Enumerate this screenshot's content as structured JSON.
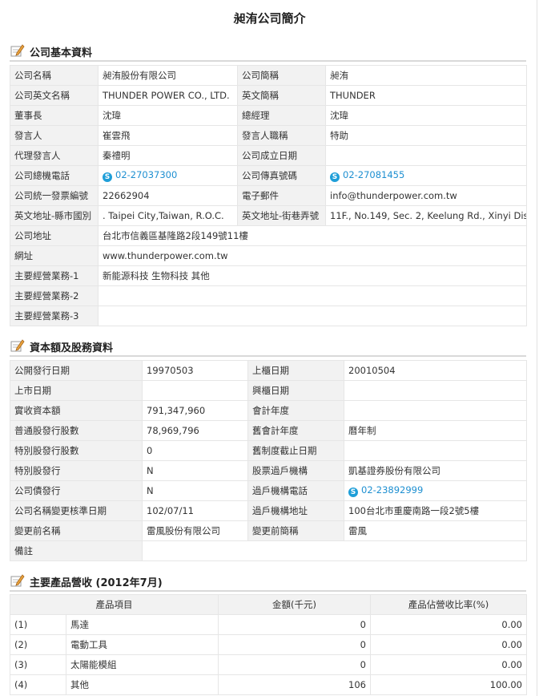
{
  "page_title": "昶洧公司簡介",
  "icons": {
    "section": "pencil-edit-icon",
    "phone": "skype-phone-icon"
  },
  "basic": {
    "title": "公司基本資料",
    "rows": [
      {
        "l1": "公司名稱",
        "v1": "昶洧股份有限公司",
        "l2": "公司簡稱",
        "v2": "昶洧"
      },
      {
        "l1": "公司英文名稱",
        "v1": "THUNDER POWER CO., LTD.",
        "l2": "英文簡稱",
        "v2": "THUNDER"
      },
      {
        "l1": "董事長",
        "v1": "沈瑋",
        "l2": "總經理",
        "v2": "沈瑋"
      },
      {
        "l1": "發言人",
        "v1": "崔雲飛",
        "l2": "發言人職稱",
        "v2": "特助"
      },
      {
        "l1": "代理發言人",
        "v1": "秦禮明",
        "l2": "公司成立日期",
        "v2": ""
      },
      {
        "l1": "公司總機電話",
        "v1": "02-27037300",
        "l2": "公司傳真號碼",
        "v2": "02-27081455",
        "phone": true
      },
      {
        "l1": "公司統一發票編號",
        "v1": "22662904",
        "l2": "電子郵件",
        "v2": "info@thunderpower.com.tw"
      },
      {
        "l1": "英文地址-縣市國別",
        "v1": ". Taipei City,Taiwan, R.O.C.",
        "l2": "英文地址-街巷弄號",
        "v2": "11F., No.149, Sec. 2, Keelung Rd., Xinyi Dis"
      }
    ],
    "wide_rows": [
      {
        "l": "公司地址",
        "v": "台北市信義區基隆路2段149號11樓"
      },
      {
        "l": "網址",
        "v": "www.thunderpower.com.tw"
      },
      {
        "l": "主要經營業務-1",
        "v": "新能源科技 生物科技 其他"
      },
      {
        "l": "主要經營業務-2",
        "v": ""
      },
      {
        "l": "主要經營業務-3",
        "v": ""
      }
    ]
  },
  "capital": {
    "title": "資本額及股務資料",
    "rows": [
      {
        "l1": "公開發行日期",
        "v1": "19970503",
        "l2": "上櫃日期",
        "v2": "20010504"
      },
      {
        "l1": "上市日期",
        "v1": "",
        "l2": "興櫃日期",
        "v2": ""
      },
      {
        "l1": "實收資本額",
        "v1": "791,347,960",
        "l2": "會計年度",
        "v2": ""
      },
      {
        "l1": "普通股發行股數",
        "v1": "78,969,796",
        "l2": "舊會計年度",
        "v2": "曆年制"
      },
      {
        "l1": "特別股發行股數",
        "v1": "0",
        "l2": "舊制度截止日期",
        "v2": ""
      },
      {
        "l1": "特別股發行",
        "v1": "N",
        "l2": "股票過戶機構",
        "v2": "凱基證券股份有限公司"
      },
      {
        "l1": "公司債發行",
        "v1": "N",
        "l2": "過戶機構電話",
        "v2": "02-23892999",
        "phone2": true
      },
      {
        "l1": "公司名稱變更核準日期",
        "v1": "102/07/11",
        "l2": "過戶機構地址",
        "v2": "100台北市重慶南路一段2號5樓"
      },
      {
        "l1": "變更前名稱",
        "v1": "雷風股份有限公司",
        "l2": "變更前簡稱",
        "v2": "雷風"
      }
    ],
    "note_label": "備註",
    "note_value": ""
  },
  "products": {
    "title": "主要產品營收 (2012年7月)",
    "headers": [
      "產品項目",
      "金額(千元)",
      "產品佔營收比率(%)"
    ],
    "rows": [
      {
        "idx": "(1)",
        "name": "馬達",
        "amount": "0",
        "ratio": "0.00"
      },
      {
        "idx": "(2)",
        "name": "電動工具",
        "amount": "0",
        "ratio": "0.00"
      },
      {
        "idx": "(3)",
        "name": "太陽能模組",
        "amount": "0",
        "ratio": "0.00"
      },
      {
        "idx": "(4)",
        "name": "其他",
        "amount": "106",
        "ratio": "100.00"
      }
    ]
  }
}
